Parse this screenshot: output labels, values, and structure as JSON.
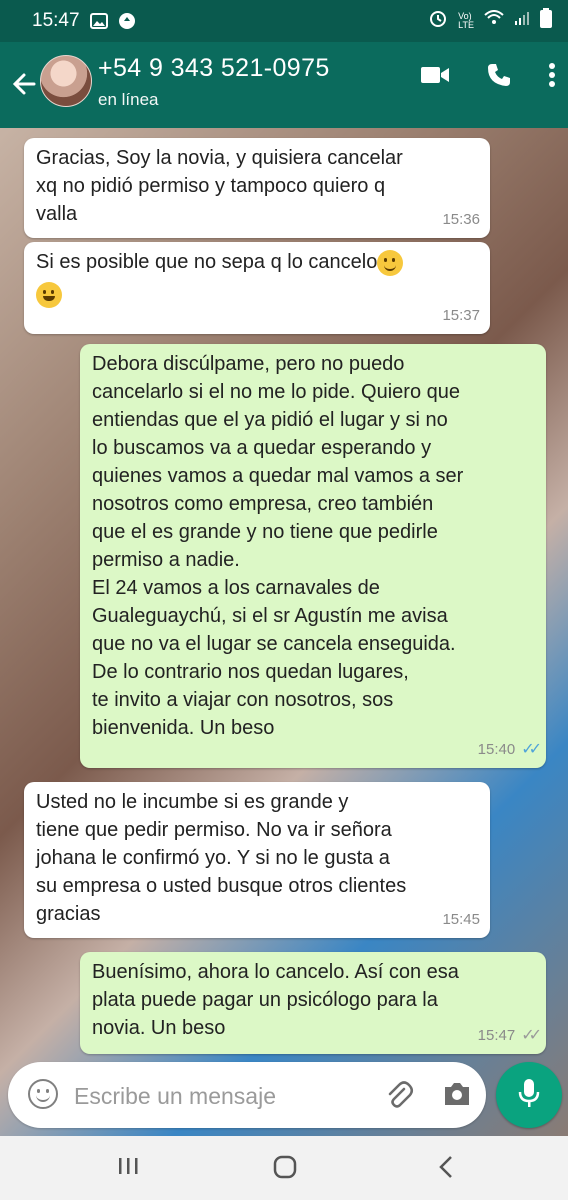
{
  "status": {
    "time": "15:47",
    "net": "Vo)\nLTE"
  },
  "header": {
    "contact": "+54 9 343 521-0975",
    "presence": "en línea"
  },
  "messages": [
    {
      "dir": "in",
      "text": "Gracias, Soy la novia, y quisiera cancelar\nxq no pidió permiso y tampoco quiero q\nvalla",
      "time": "15:36"
    },
    {
      "dir": "in",
      "text": "Si es posible que no sepa q lo cancelo",
      "emoji": [
        "slightly-smiling-face",
        "face-with-tears-of-joy"
      ],
      "time": "15:37"
    },
    {
      "dir": "out",
      "text": "Debora discúlpame, pero no puedo\ncancelarlo si el no me lo pide. Quiero que\nentiendas que el ya pidió el lugar y si no\nlo buscamos va a quedar esperando y\nquienes vamos a quedar mal vamos a ser\nnosotros como empresa, creo también\nque el es grande y no tiene que pedirle\npermiso a nadie.\nEl 24 vamos a los carnavales de\nGualeguaychú, si el sr Agustín me avisa\nque no va el lugar se cancela enseguida.\nDe lo contrario nos quedan lugares,\nte invito a viajar con nosotros, sos\nbienvenida. Un beso",
      "time": "15:40",
      "read": true
    },
    {
      "dir": "in",
      "text": "Usted no le incumbe si es grande y\ntiene que pedir permiso. No va ir señora\njohana le confirmó yo. Y si no le gusta a\nsu empresa o usted busque otros clientes\ngracias",
      "time": "15:45"
    },
    {
      "dir": "out",
      "text": "Buenísimo,  ahora lo cancelo. Así con esa\nplata puede pagar un psicólogo para la\nnovia. Un beso",
      "time": "15:47",
      "read": false
    }
  ],
  "composer": {
    "placeholder": "Escribe un mensaje"
  },
  "icons": [
    "back-arrow-icon",
    "video-call-icon",
    "phone-icon",
    "more-vert-icon",
    "emoji-icon",
    "attach-icon",
    "camera-icon",
    "mic-icon"
  ],
  "colors": {
    "header": "#0b6b5d",
    "incoming": "#ffffff",
    "outgoing": "#dcf8c6",
    "read_ticks": "#4fa3d9",
    "mic": "#0aa37f"
  }
}
